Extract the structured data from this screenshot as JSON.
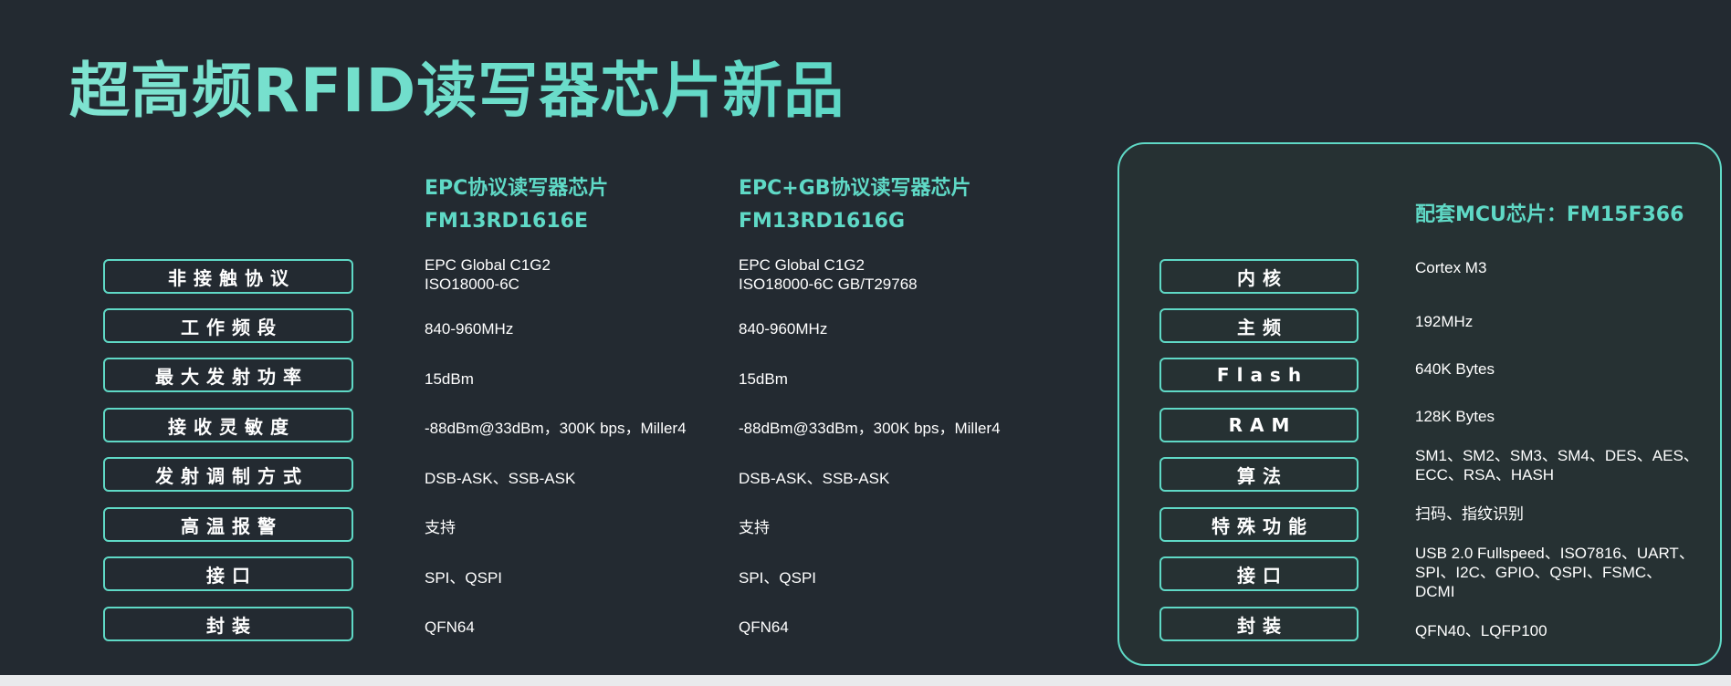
{
  "title": "超高频RFID读写器芯片新品",
  "columns": {
    "epc": {
      "protocol": "EPC协议读写器芯片",
      "model": "FM13RD1616E"
    },
    "epcgb": {
      "protocol": "EPC+GB协议读写器芯片",
      "model": "FM13RD1616G"
    }
  },
  "rows": [
    {
      "label": "非接触协议",
      "epc": "EPC Global C1G2\nISO18000-6C",
      "epcgb": "EPC Global C1G2\nISO18000-6C     GB/T29768"
    },
    {
      "label": "工作频段",
      "epc": "840-960MHz",
      "epcgb": "840-960MHz"
    },
    {
      "label": "最大发射功率",
      "epc": "15dBm",
      "epcgb": "15dBm"
    },
    {
      "label": "接收灵敏度",
      "epc": "-88dBm@33dBm，300K bps，Miller4",
      "epcgb": "-88dBm@33dBm，300K bps，Miller4"
    },
    {
      "label": "发射调制方式",
      "epc": "DSB-ASK、SSB-ASK",
      "epcgb": "DSB-ASK、SSB-ASK"
    },
    {
      "label": "高温报警",
      "epc": "支持",
      "epcgb": "支持"
    },
    {
      "label": "接口",
      "epc": "SPI、QSPI",
      "epcgb": "SPI、QSPI"
    },
    {
      "label": "封装",
      "epc": "QFN64",
      "epcgb": "QFN64"
    }
  ],
  "mcu": {
    "heading": "配套MCU芯片：FM15F366",
    "rows": [
      {
        "label": "内核",
        "value": "Cortex M3"
      },
      {
        "label": "主频",
        "value": "192MHz"
      },
      {
        "label": "Flash",
        "value": "640K Bytes"
      },
      {
        "label": "RAM",
        "value": "128K Bytes"
      },
      {
        "label": "算法",
        "value": "SM1、SM2、SM3、SM4、DES、AES、\nECC、RSA、HASH"
      },
      {
        "label": "特殊功能",
        "value": "扫码、指纹识别"
      },
      {
        "label": "接口",
        "value": "USB 2.0 Fullspeed、ISO7816、UART、\nSPI、I2C、GPIO、QSPI、FSMC、\nDCMI"
      },
      {
        "label": "封装",
        "value": "QFN40、LQFP100"
      }
    ]
  },
  "colors": {
    "accent": "#5fd9c6",
    "background": "#232a31"
  }
}
